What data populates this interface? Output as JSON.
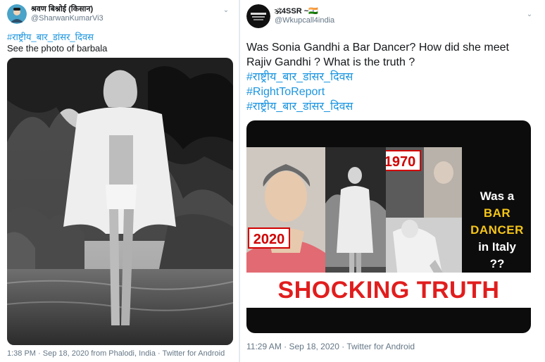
{
  "left_tweet": {
    "display_name": "श्रवण बिश्नोई (किसान)",
    "handle": "@SharwanKumarVi3",
    "hashtag": "#राष्ट्रीय_बार_डांसर_दिवस",
    "text": "See the photo of barbala",
    "timestamp": "1:38 PM · Sep 18, 2020 from Phalodi, India · Twitter for Android"
  },
  "right_tweet": {
    "display_name": "🕉4SSR ~🇮🇳",
    "handle": "@Wkupcall4india",
    "text_line1": "Was Sonia Gandhi a Bar Dancer? How did she meet",
    "text_line2": "Rajiv Gandhi ? What is the truth ?",
    "hashtags": [
      "#राष्ट्रीय_बार_डांसर_दिवस",
      "#RightToReport",
      "#राष्ट्रीय_बार_डांसर_दिवस"
    ],
    "timestamp": "11:29 AM · Sep 18, 2020 · Twitter for Android",
    "image": {
      "badge_left": "2020",
      "badge_right": "1970",
      "side_line1": "Was a",
      "side_line2": "BAR",
      "side_line3": "DANCER",
      "side_line4": "in Italy",
      "side_line5": "??",
      "banner": "SHOCKING  TRUTH"
    }
  },
  "icons": {
    "chevron": "chevron-down-icon",
    "avatar_left": "avatar-portrait",
    "avatar_right": "avatar-logo"
  }
}
